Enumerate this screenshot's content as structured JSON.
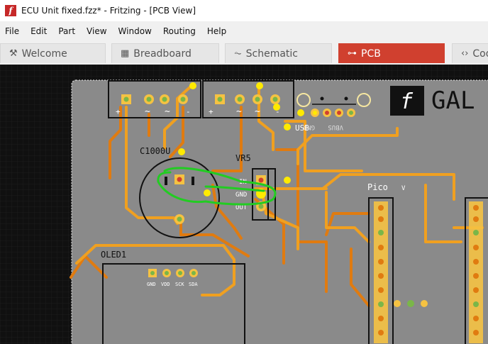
{
  "window": {
    "title": "ECU Unit fixed.fzz* - Fritzing - [PCB View]",
    "app_icon": "fritzing-f-icon"
  },
  "menu": [
    "File",
    "Edit",
    "Part",
    "View",
    "Window",
    "Routing",
    "Help"
  ],
  "tabs": [
    {
      "label": "Welcome",
      "icon": "welcome-icon"
    },
    {
      "label": "Breadboard",
      "icon": "breadboard-icon"
    },
    {
      "label": "Schematic",
      "icon": "schematic-icon"
    },
    {
      "label": "PCB",
      "icon": "pcb-icon",
      "active": true
    },
    {
      "label": "Code",
      "icon": "code-icon"
    }
  ],
  "pcb": {
    "labels": {
      "cap": "C1000U",
      "reg": "VR5",
      "reg_in": "IN",
      "reg_gnd": "GND",
      "reg_out": "OUT",
      "usb": "USB",
      "usb_gnd": "GND",
      "usb_vbus": "VBUS",
      "pico": "Pico",
      "pico_v": "V",
      "oled": "OLED1",
      "oled_gnd": "GND",
      "oled_vdd": "VDD",
      "oled_sck": "SCK",
      "oled_sda": "SDA",
      "logo": "GAL",
      "bridge1_plus": "+",
      "bridge1_tilde1": "~",
      "bridge1_tilde2": "~",
      "bridge1_minus": "-",
      "bridge2_plus": "+",
      "bridge2_tilde1": "~",
      "bridge2_tilde2": "~",
      "bridge2_minus": "-"
    },
    "colors": {
      "board": "#8a8a8a",
      "trace_top": "#f0a020",
      "trace_bottom": "#e07b10",
      "ratsnest": "#ffea00",
      "pad": "#f5c242",
      "highlight": "#22cc22",
      "active_tab": "#d0402f"
    }
  }
}
